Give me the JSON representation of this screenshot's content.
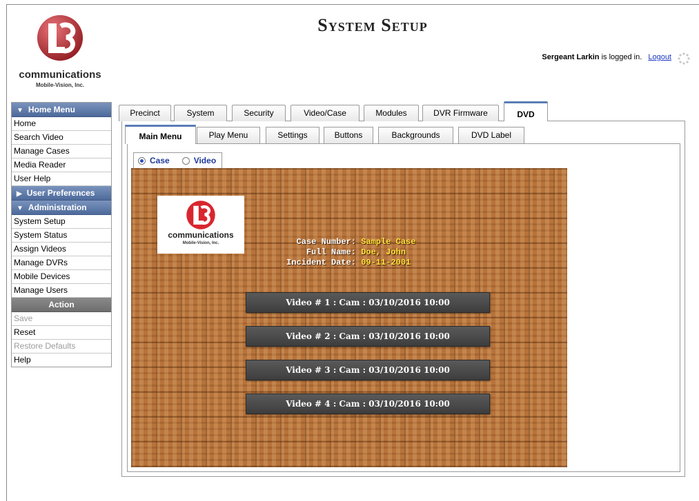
{
  "header": {
    "title": "System Setup",
    "user": "Sergeant Larkin",
    "logged_in_text": " is logged in.",
    "logout": "Logout"
  },
  "logo": {
    "wordmark": "communications",
    "subtitle": "Mobile-Vision, Inc."
  },
  "sidebar": {
    "home_menu": {
      "title": "Home Menu",
      "items": [
        "Home",
        "Search Video",
        "Manage Cases",
        "Media Reader",
        "User Help"
      ]
    },
    "user_prefs": {
      "title": "User Preferences"
    },
    "administration": {
      "title": "Administration",
      "items": [
        "System Setup",
        "System Status",
        "Assign Videos",
        "Manage DVRs",
        "Mobile Devices",
        "Manage Users"
      ]
    },
    "action": {
      "title": "Action",
      "items": [
        {
          "label": "Save",
          "enabled": false
        },
        {
          "label": "Reset",
          "enabled": true
        },
        {
          "label": "Restore Defaults",
          "enabled": false
        },
        {
          "label": "Help",
          "enabled": true
        }
      ]
    }
  },
  "tabs": [
    "Precinct",
    "System",
    "Security",
    "Video/Case",
    "Modules",
    "DVR Firmware",
    "DVD"
  ],
  "active_tab": "DVD",
  "subtabs": [
    "Main Menu",
    "Play Menu",
    "Settings",
    "Buttons",
    "Backgrounds",
    "DVD Label"
  ],
  "active_subtab": "Main Menu",
  "radio": {
    "options": [
      "Case",
      "Video"
    ],
    "selected": "Case"
  },
  "preview": {
    "logo_wordmark": "communications",
    "logo_subtitle": "Mobile-Vision, Inc.",
    "case_info": [
      {
        "label": "Case Number:",
        "value": "Sample Case"
      },
      {
        "label": "Full Name:",
        "value": "Doe, John"
      },
      {
        "label": "Incident Date:",
        "value": "09-11-2001"
      }
    ],
    "video_buttons": [
      "Video # 1 : Cam : 03/10/2016 10:00",
      "Video # 2 : Cam : 03/10/2016 10:00",
      "Video # 3 : Cam : 03/10/2016 10:00",
      "Video # 4 : Cam : 03/10/2016 10:00"
    ]
  },
  "colors": {
    "menu_header": "#5b77a6",
    "tab_accent": "#5a7db5",
    "link": "#1a36c0",
    "case_value": "#ffe23a",
    "background_wood": "#b7733a"
  }
}
